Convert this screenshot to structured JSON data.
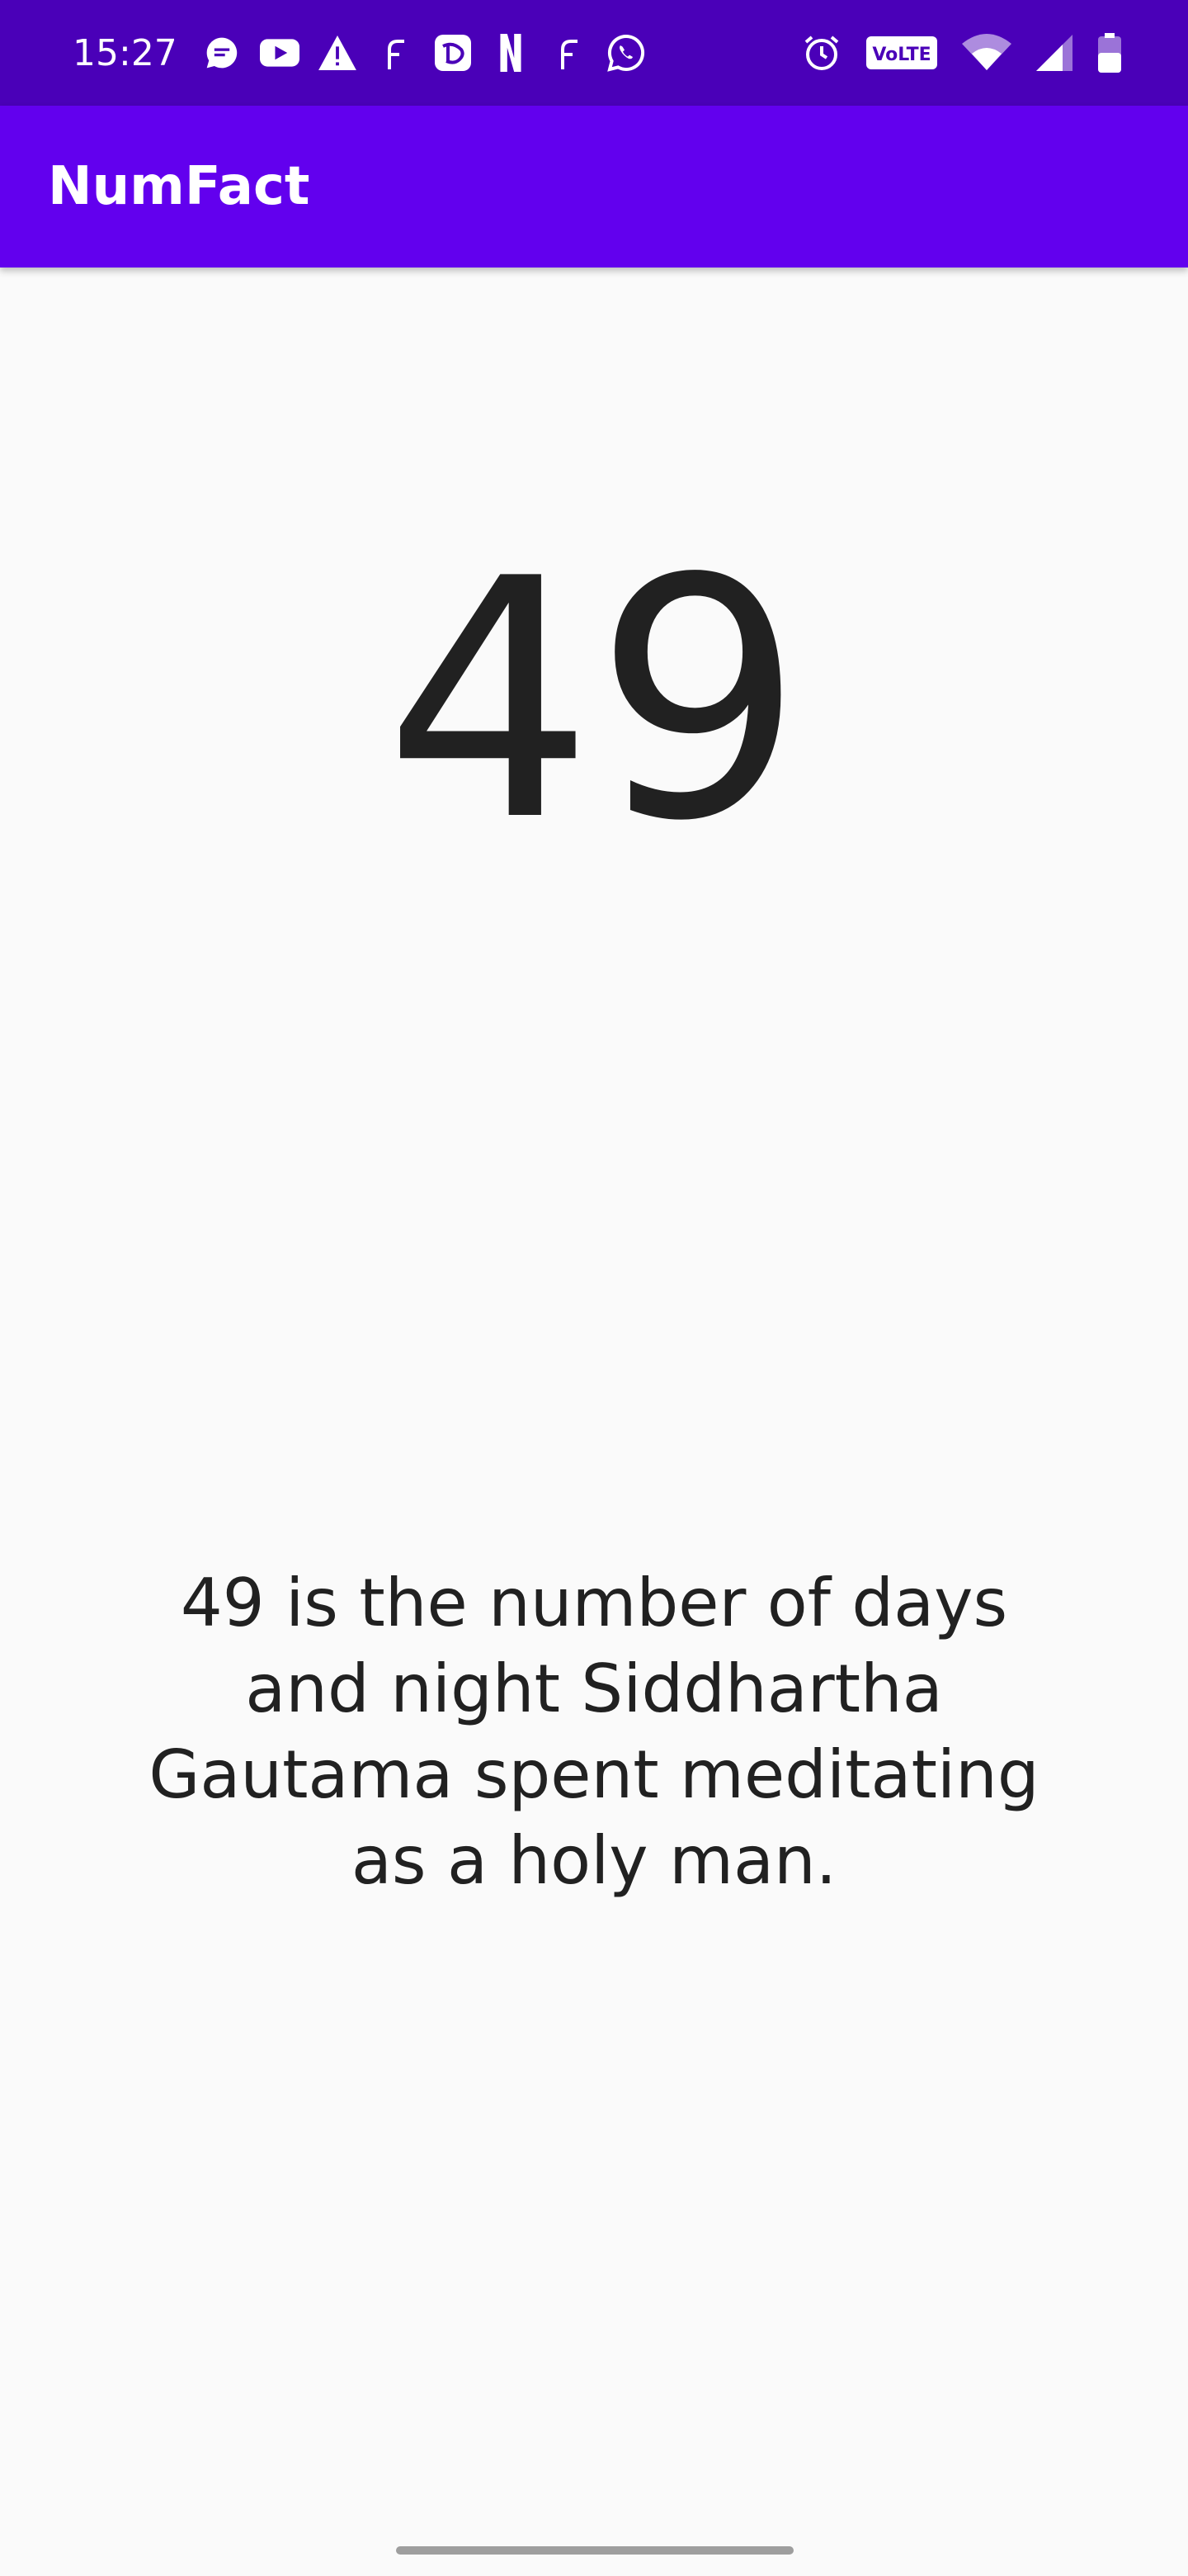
{
  "status_bar": {
    "time": "15:27",
    "left_icons": [
      "chat-icon",
      "youtube-icon",
      "warning-icon",
      "f-icon",
      "disney-icon",
      "netflix-icon",
      "f-icon",
      "whatsapp-icon"
    ],
    "right_icons": [
      "alarm-icon",
      "volte-icon",
      "wifi-icon",
      "signal-icon",
      "battery-icon"
    ],
    "volte_label": "VoLTE"
  },
  "app_bar": {
    "title": "NumFact"
  },
  "main": {
    "number": "49",
    "fact": "49 is the number of days and night Siddhartha Gautama spent meditating as a holy man."
  },
  "colors": {
    "status_bar": "#4a00b8",
    "app_bar": "#6200ee",
    "background": "#fafafa",
    "text": "#212121"
  }
}
